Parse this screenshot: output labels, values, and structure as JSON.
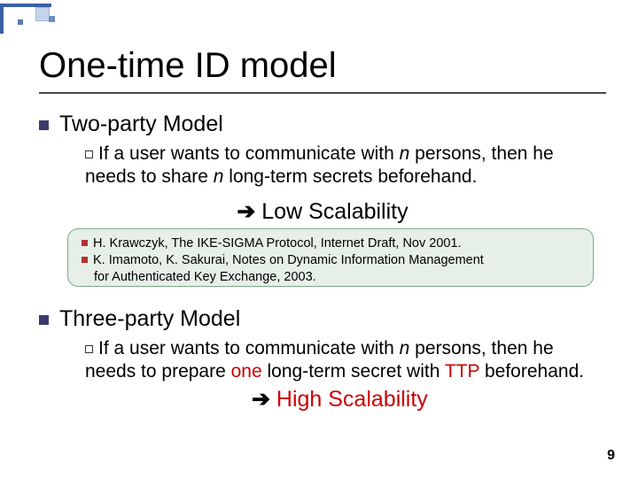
{
  "slide": {
    "title": "One-time ID model",
    "section1": {
      "heading": "Two-party Model",
      "bullet_prefix": "If",
      "bullet_text_1": " a user wants to communicate with ",
      "n1": "n",
      "bullet_text_2": " persons, then he needs to share ",
      "n2": "n",
      "bullet_text_3": " long-term secrets beforehand.",
      "arrow": "➔",
      "conclusion": " Low Scalability"
    },
    "refs": {
      "r1": "H. Krawczyk, The IKE-SIGMA Protocol, Internet Draft, Nov 2001.",
      "r2a": "K. Imamoto, K. Sakurai, Notes on Dynamic Information Management",
      "r2b": "for Authenticated Key Exchange, 2003."
    },
    "section2": {
      "heading": "Three-party Model",
      "bullet_prefix": "If",
      "bullet_text_1": " a user wants to communicate with ",
      "n1": "n",
      "bullet_text_2": " persons, then he needs to prepare ",
      "highlight1": "one",
      "bullet_text_3": " long-term secret with ",
      "highlight2": "TTP",
      "bullet_text_4": " beforehand.",
      "arrow": "➔",
      "conclusion": " High Scalability"
    },
    "page": "9"
  }
}
